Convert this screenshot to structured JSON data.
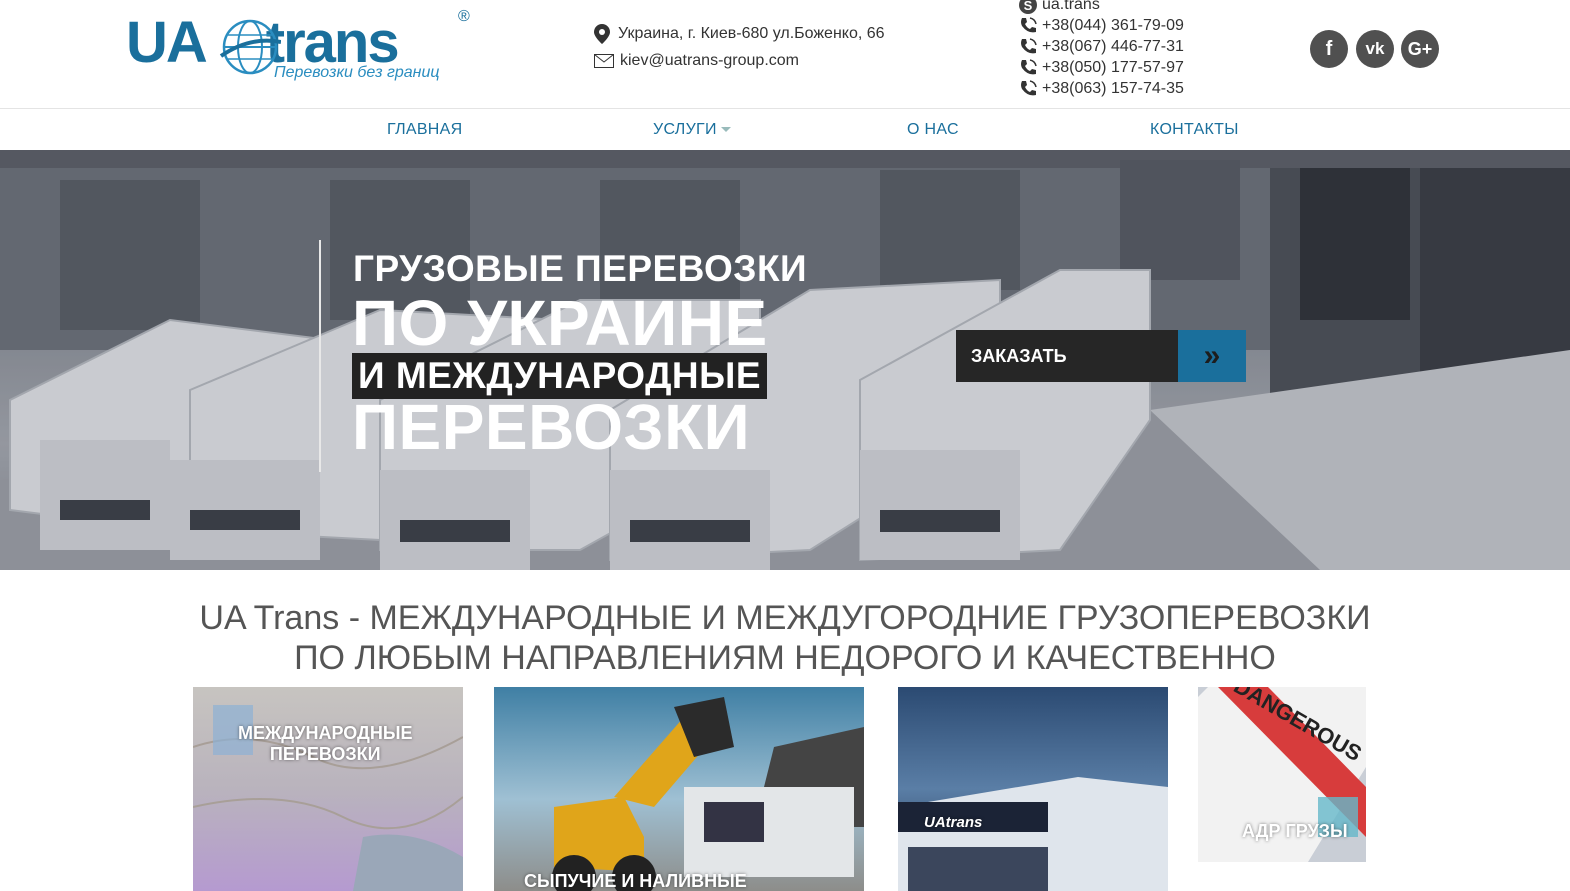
{
  "header": {
    "logo": {
      "brand_ua": "UA",
      "brand_trans": "trans",
      "reg": "®",
      "slogan": "Перевозки без границ"
    },
    "address": "Украина, г. Киев-680 ул.Боженко, 66",
    "email": "kiev@uatrans-group.com",
    "skype": "ua.trans",
    "phones": [
      "+38(044) 361-79-09",
      "+38(067) 446-77-31",
      "+38(050) 177-57-97",
      "+38(063) 157-74-35"
    ],
    "social": {
      "facebook": "f",
      "vk": "vk",
      "gplus": "G+"
    }
  },
  "nav": {
    "home": "ГЛАВНАЯ",
    "services": "УСЛУГИ",
    "about": "О НАС",
    "contacts": "КОНТАКТЫ"
  },
  "hero": {
    "line1": "ГРУЗОВЫЕ ПЕРЕВОЗКИ",
    "line2": "ПО УКРАИНЕ",
    "line3": "И МЕЖДУНАРОДНЫЕ",
    "line4": "ПЕРЕВОЗКИ",
    "order_button": "ЗАКАЗАТЬ",
    "order_arrow": "»"
  },
  "section": {
    "title_line1": "UA Trans - МЕЖДУНАРОДНЫЕ И МЕЖДУГОРОДНИЕ ГРУЗОПЕРЕВОЗКИ",
    "title_line2": "ПО ЛЮБЫМ НАПРАВЛЕНИЯМ НЕДОРОГО И КАЧЕСТВЕННО"
  },
  "cards": [
    {
      "label_line1": "МЕЖДУНАРОДНЫЕ",
      "label_line2": "ПЕРЕВОЗКИ"
    },
    {
      "label_line1": "СЫПУЧИЕ И НАЛИВНЫЕ"
    },
    {
      "truck_logo": "UAtrans"
    },
    {
      "label_line1": "АДР ГРУЗЫ",
      "sign_text": "DANGEROUS"
    }
  ],
  "colors": {
    "brand_blue": "#1a6f9c",
    "dark": "#262626",
    "social_grey": "#505050"
  }
}
